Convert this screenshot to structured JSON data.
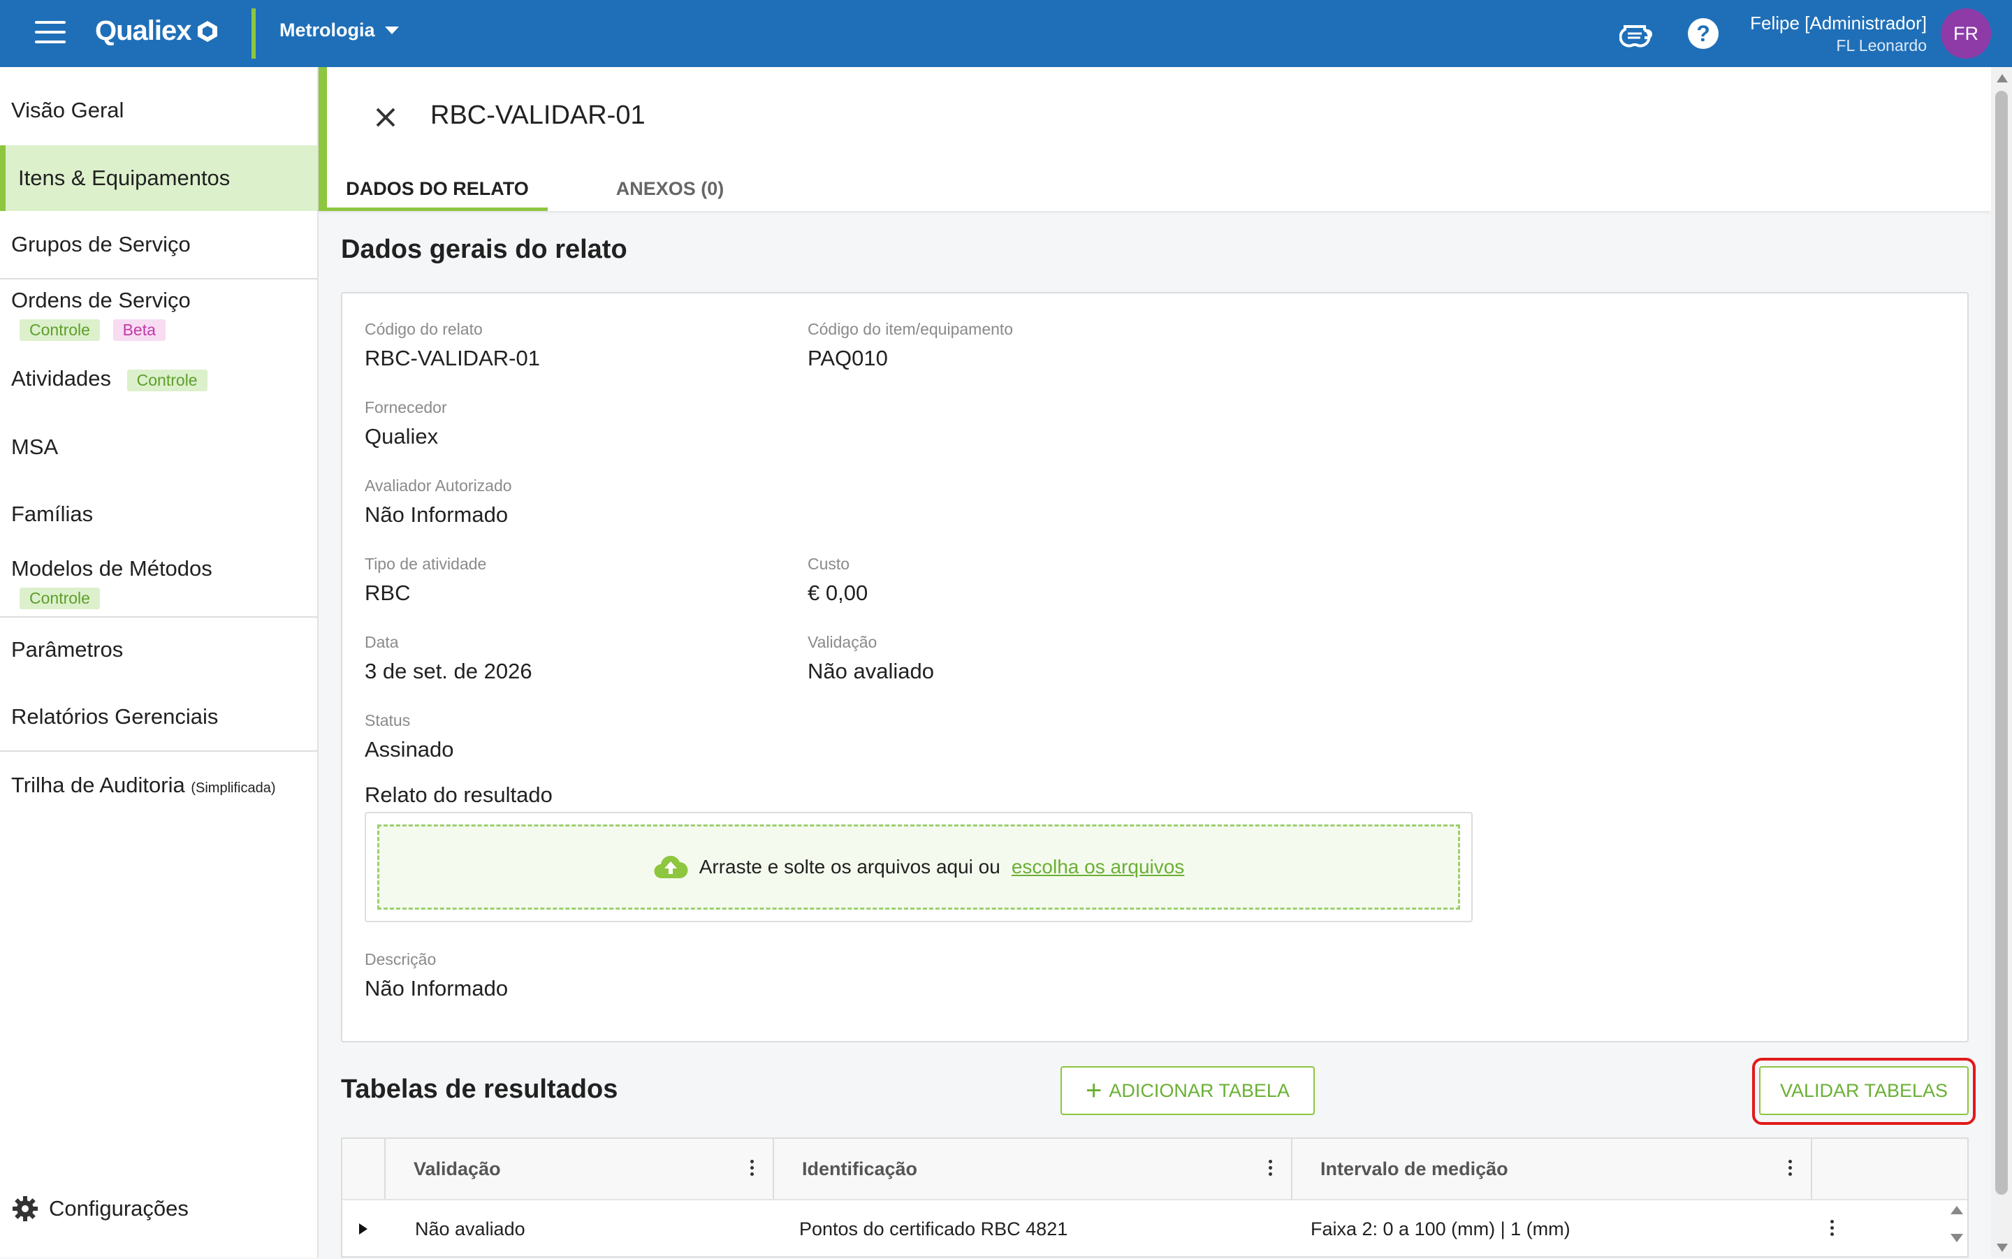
{
  "topbar": {
    "app_name": "Qualiex",
    "module": "Metrologia",
    "user_name": "Felipe [Administrador]",
    "user_org": "FL Leonardo",
    "avatar_initials": "FR",
    "help_glyph": "?",
    "bar_color": "#1f6fb8",
    "accent_color": "#8dc63f"
  },
  "sidebar": {
    "items": [
      {
        "label": "Visão Geral"
      },
      {
        "label": "Itens & Equipamentos"
      },
      {
        "label": "Grupos de Serviço"
      },
      {
        "label": "Ordens de Serviço",
        "tags": [
          "Controle",
          "Beta"
        ]
      },
      {
        "label": "Atividades",
        "tags": [
          "Controle"
        ]
      },
      {
        "label": "MSA"
      },
      {
        "label": "Famílias"
      },
      {
        "label": "Modelos de Métodos",
        "tags": [
          "Controle"
        ]
      },
      {
        "label": "Parâmetros"
      },
      {
        "label": "Relatórios Gerenciais"
      },
      {
        "label": "Trilha de Auditoria",
        "suffix": "(Simplificada)"
      }
    ],
    "config_label": "Configurações"
  },
  "header": {
    "title": "RBC-VALIDAR-01",
    "tabs": [
      {
        "label": "DADOS DO RELATO"
      },
      {
        "label": "ANEXOS (0)"
      }
    ]
  },
  "general": {
    "section_title": "Dados gerais do relato",
    "fields": {
      "codigo_relato": {
        "label": "Código do relato",
        "value": "RBC-VALIDAR-01"
      },
      "codigo_item": {
        "label": "Código do item/equipamento",
        "value": "PAQ010"
      },
      "fornecedor": {
        "label": "Fornecedor",
        "value": "Qualiex"
      },
      "avaliador": {
        "label": "Avaliador Autorizado",
        "value": "Não Informado"
      },
      "tipo": {
        "label": "Tipo de atividade",
        "value": "RBC"
      },
      "custo": {
        "label": "Custo",
        "value": "€ 0,00"
      },
      "data": {
        "label": "Data",
        "value": "3 de set. de 2026"
      },
      "validacao": {
        "label": "Validação",
        "value": "Não avaliado"
      },
      "status": {
        "label": "Status",
        "value": "Assinado"
      },
      "descricao": {
        "label": "Descrição",
        "value": "Não Informado"
      }
    },
    "relato_title": "Relato do resultado",
    "dropzone_text": "Arraste e solte os arquivos aqui ou",
    "dropzone_link": "escolha os arquivos"
  },
  "results": {
    "section_title": "Tabelas de resultados",
    "add_button": "ADICIONAR TABELA",
    "add_glyph": "+",
    "validate_button": "VALIDAR TABELAS",
    "columns": [
      "Validação",
      "Identificação",
      "Intervalo de medição"
    ],
    "rows": [
      {
        "validacao": "Não avaliado",
        "identificacao": "Pontos do certificado RBC 4821",
        "intervalo": "Faixa 2: 0 a 100 (mm) | 1 (mm)"
      }
    ]
  }
}
